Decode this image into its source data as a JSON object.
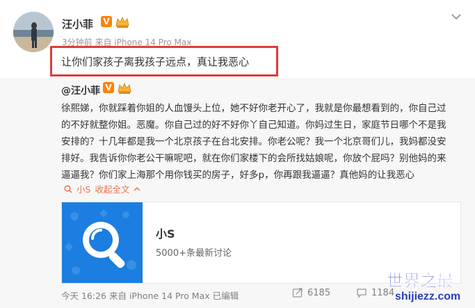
{
  "post": {
    "username": "汪小菲",
    "meta": "3分钟前 来自 iPhone 14 Pro Max",
    "text": "让你们家孩子离我孩子远点，真让我恶心"
  },
  "repost": {
    "username": "@汪小菲",
    "lines": [
      "徐熙娣，你就踩着你姐的人血馒头上位，她不好你老开心了，我就是你最想看到的，你自己过",
      "的不好就整你姐。恶魔。你自己过的好不好你丫自己知道。你妈过生日，家庭节日哪个不是我",
      "安排的？十几年都是我一个北京孩子在台北安排。你老公呢？我一个北京哥们儿，我妈都没安",
      "排好。我告诉你你老公干嘛呢吧，就在你们家楼下的会所找姑娘呢，你放个屁吗？别他妈的来",
      "逼逼我？你们家上海那个用你钱买的房子，好多p，你再跟我逼逼？真他妈的让我恶心"
    ],
    "expand": {
      "name_link": "小S",
      "collapse_label": "收起全文"
    },
    "topic": {
      "title": "小S",
      "subtitle": "5000+条最新讨论"
    },
    "footer": {
      "meta": "今天 16:26 来自 iPhone 14 Pro Max  已编辑",
      "shares": "6185",
      "comments": "1184"
    }
  },
  "watermark": {
    "title": "世界之最",
    "url": "shijiezz.com"
  },
  "colors": {
    "highlight": "#e03b3b",
    "link": "#eb7350",
    "topic_blue": "#1b7ee0",
    "vip_orange": "#ff8200"
  }
}
